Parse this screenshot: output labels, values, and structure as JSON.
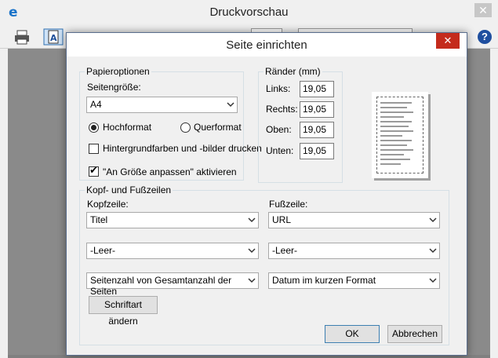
{
  "window": {
    "title": "Druckvorschau"
  },
  "dialog": {
    "title": "Seite einrichten",
    "paper": {
      "legend": "Papieroptionen",
      "size_label": "Seitengröße:",
      "size_value": "A4",
      "portrait_label": "Hochformat",
      "landscape_label": "Querformat",
      "background_label": "Hintergrundfarben und -bilder drucken",
      "shrink_label": "\"An Größe anpassen\" aktivieren"
    },
    "margins": {
      "legend": "Ränder (mm)",
      "left_label": "Links:",
      "left_value": "19,05",
      "right_label": "Rechts:",
      "right_value": "19,05",
      "top_label": "Oben:",
      "top_value": "19,05",
      "bottom_label": "Unten:",
      "bottom_value": "19,05"
    },
    "header_footer": {
      "legend": "Kopf- und Fußzeilen",
      "header_label": "Kopfzeile:",
      "footer_label": "Fußzeile:",
      "header_1": "Titel",
      "header_2": "-Leer-",
      "header_3": "Seitenzahl von Gesamtanzahl der Seiten",
      "footer_1": "URL",
      "footer_2": "-Leer-",
      "footer_3": "Datum im kurzen Format",
      "font_button": "Schriftart ändern"
    },
    "ok": "OK",
    "cancel": "Abbrechen"
  }
}
